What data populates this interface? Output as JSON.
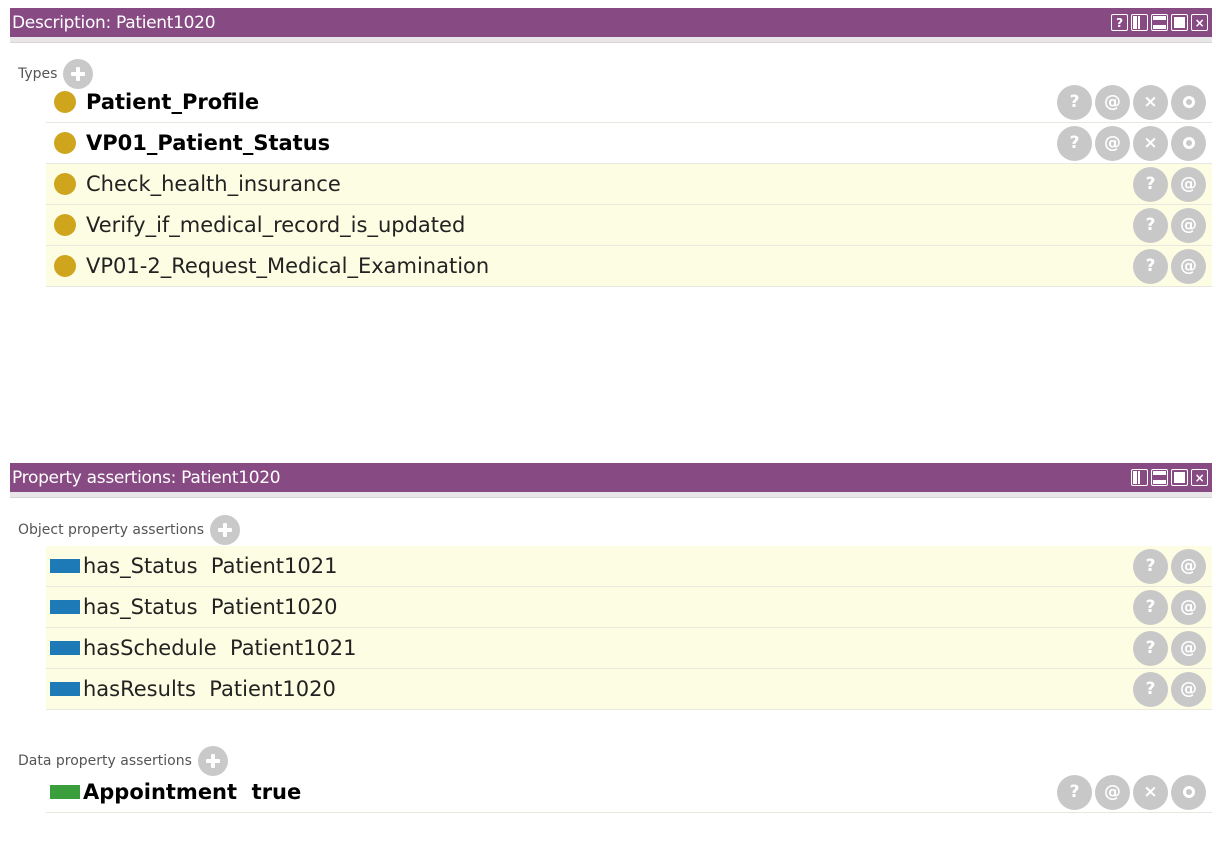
{
  "description_panel": {
    "title": "Description: Patient1020",
    "window_buttons": [
      "?",
      "split",
      "minimize",
      "maximize",
      "close"
    ],
    "types_header": "Types",
    "types": [
      {
        "label": "Patient_Profile",
        "asserted": true
      },
      {
        "label": "VP01_Patient_Status",
        "asserted": true
      },
      {
        "label": "Check_health_insurance",
        "asserted": false
      },
      {
        "label": "Verify_if_medical_record_is_updated",
        "asserted": false
      },
      {
        "label": "VP01-2_Request_Medical_Examination",
        "asserted": false
      }
    ]
  },
  "property_panel": {
    "title": "Property assertions: Patient1020",
    "object_header": "Object property assertions",
    "object_assertions": [
      {
        "label": "has_Status  Patient1021"
      },
      {
        "label": "has_Status  Patient1020"
      },
      {
        "label": "hasSchedule  Patient1021"
      },
      {
        "label": "hasResults  Patient1020"
      }
    ],
    "data_header": "Data property assertions",
    "data_assertions": [
      {
        "label": "Appointment  true"
      }
    ]
  },
  "action_glyphs": {
    "explain": "?",
    "annotate": "@",
    "delete": "×"
  },
  "colors": {
    "titlebar": "#874a83",
    "type_dot": "#cfa51e",
    "object_property": "#1d7ab6",
    "data_property": "#3a9e3c",
    "inferred_row": "#fdfde3"
  }
}
